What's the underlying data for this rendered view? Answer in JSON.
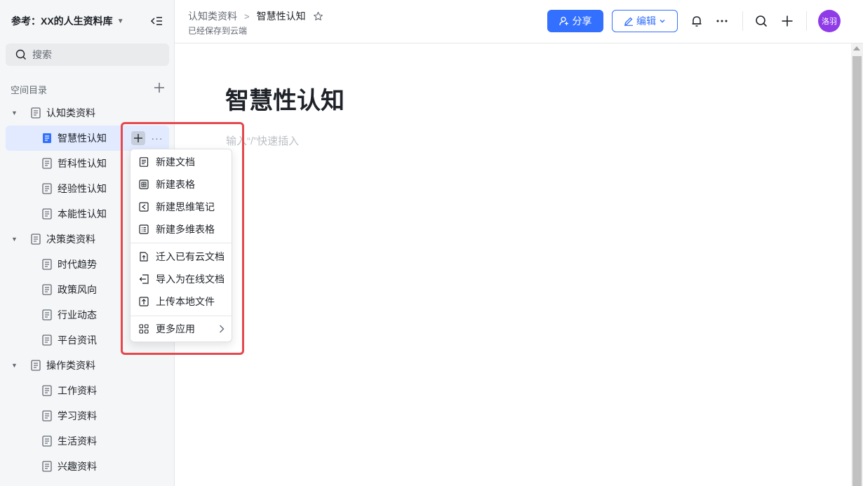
{
  "sidebar": {
    "space_title": "参考：XX的人生资料库",
    "search_placeholder": "搜索",
    "directory_label": "空间目录",
    "tree": [
      {
        "label": "认知类资料",
        "level": 0
      },
      {
        "label": "智慧性认知",
        "level": 1,
        "active": true
      },
      {
        "label": "哲科性认知",
        "level": 1
      },
      {
        "label": "经验性认知",
        "level": 1
      },
      {
        "label": "本能性认知",
        "level": 1
      },
      {
        "label": "决策类资料",
        "level": 0
      },
      {
        "label": "时代趋势",
        "level": 1
      },
      {
        "label": "政策风向",
        "level": 1
      },
      {
        "label": "行业动态",
        "level": 1
      },
      {
        "label": "平台资讯",
        "level": 1
      },
      {
        "label": "操作类资料",
        "level": 0
      },
      {
        "label": "工作资料",
        "level": 1
      },
      {
        "label": "学习资料",
        "level": 1
      },
      {
        "label": "生活资料",
        "level": 1
      },
      {
        "label": "兴趣资料",
        "level": 1
      }
    ]
  },
  "header": {
    "breadcrumb_parent": "认知类资料",
    "breadcrumb_current": "智慧性认知",
    "saved_status": "已经保存到云端",
    "share_label": "分享",
    "edit_label": "编辑",
    "avatar_text": "洛羽"
  },
  "content": {
    "title": "智慧性认知",
    "placeholder": "输入“/”快速插入"
  },
  "menu": {
    "items": [
      {
        "label": "新建文档",
        "icon": "doc-icon"
      },
      {
        "label": "新建表格",
        "icon": "sheet-icon"
      },
      {
        "label": "新建思维笔记",
        "icon": "mindnote-icon"
      },
      {
        "label": "新建多维表格",
        "icon": "bitable-icon"
      },
      {
        "label": "迁入已有云文档",
        "icon": "move-in-icon"
      },
      {
        "label": "导入为在线文档",
        "icon": "import-icon"
      },
      {
        "label": "上传本地文件",
        "icon": "upload-icon"
      },
      {
        "label": "更多应用",
        "icon": "apps-icon"
      }
    ]
  },
  "colors": {
    "accent": "#3370ff",
    "active_bg": "#e1eaff",
    "highlight": "#e5484d",
    "avatar": "#8f3be8"
  }
}
